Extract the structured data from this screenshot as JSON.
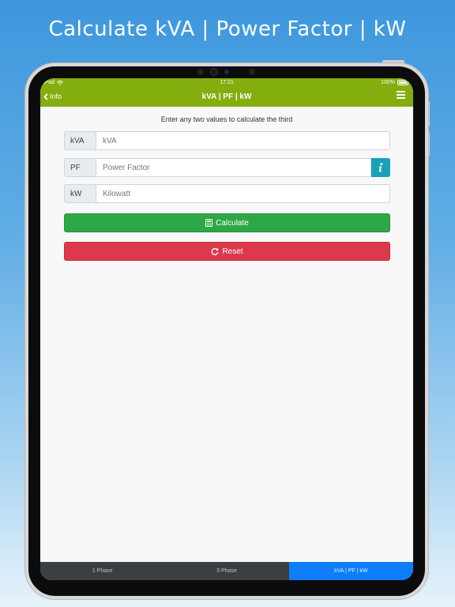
{
  "promo": {
    "title": "Calculate kVA  |  Power Factor  |  kW"
  },
  "status": {
    "carrier": "iPad",
    "time": "17:21",
    "battery": "100%"
  },
  "navbar": {
    "back_label": "Info",
    "title": "kVA | PF | kW"
  },
  "form": {
    "instruction": "Enter any two values to calculate the third",
    "fields": [
      {
        "label": "kVA",
        "placeholder": "kVA",
        "value": ""
      },
      {
        "label": "PF",
        "placeholder": "Power Factor",
        "value": ""
      },
      {
        "label": "kW",
        "placeholder": "Kilowatt",
        "value": ""
      }
    ],
    "calculate_label": "Calculate",
    "reset_label": "Reset"
  },
  "tabs": [
    {
      "label": "1 Phase",
      "active": false
    },
    {
      "label": "3 Phase",
      "active": false
    },
    {
      "label": "kVA | PF | kW",
      "active": true
    }
  ],
  "colors": {
    "navbar": "#84ad0e",
    "calculate": "#2ea746",
    "reset": "#dc3a4b",
    "info": "#17a2b8",
    "active_tab": "#0d7dfa"
  }
}
